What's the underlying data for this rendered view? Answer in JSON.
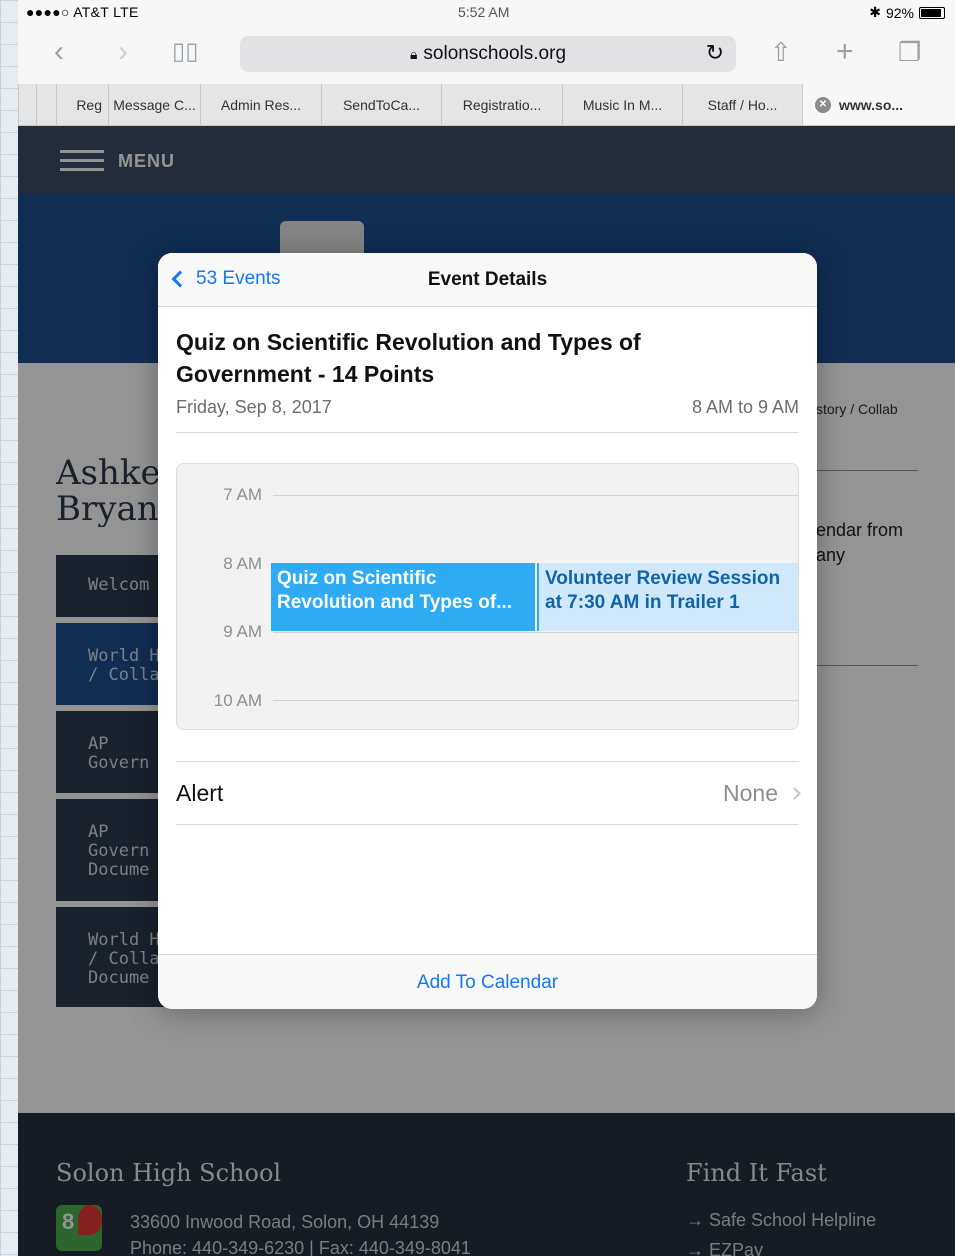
{
  "status": {
    "carrier": "●●●●○ AT&T  LTE",
    "time": "5:52 AM",
    "bluetooth": "✱",
    "battery": "92%"
  },
  "browser": {
    "url": "solonschools.org",
    "lock_icon": "lock-icon",
    "tabs": [
      {
        "label": "Reg"
      },
      {
        "label": "Message C..."
      },
      {
        "label": "Admin Res..."
      },
      {
        "label": "SendToCa..."
      },
      {
        "label": "Registratio..."
      },
      {
        "label": "Music In M..."
      },
      {
        "label": "Staff / Ho..."
      },
      {
        "label": "www.so..."
      }
    ]
  },
  "site": {
    "menu_label": "MENU",
    "breadcrumb": "story / Collab",
    "teacher_name_l1": "Ashke",
    "teacher_name_l2": "Bryan",
    "sidebar": [
      {
        "l1": "Welcom",
        "l2": "",
        "l3": ""
      },
      {
        "l1": "World H",
        "l2": "/ Collab",
        "l3": ""
      },
      {
        "l1": "AP",
        "l2": "Govern",
        "l3": ""
      },
      {
        "l1": "AP",
        "l2": "Govern",
        "l3": "Docume"
      },
      {
        "l1": "World H",
        "l2": "/ Collab",
        "l3": "Docume"
      }
    ],
    "right_text_l1": "endar from",
    "right_text_l2": "any",
    "footer": {
      "school_title": "Solon High School",
      "address": "33600 Inwood Road, Solon, OH 44139",
      "phone": "Phone: 440-349-6230  |  Fax: 440-349-8041",
      "find_title": "Find It Fast",
      "links": [
        "→  Safe School Helpline",
        "→  EZPay"
      ]
    }
  },
  "popover": {
    "back_label": "53 Events",
    "title": "Event Details",
    "event_title": "Quiz on Scientific Revolution and Types of Government - 14 Points",
    "date": "Friday, Sep 8, 2017",
    "time_range": "8 AM to 9 AM",
    "hours": [
      "7 AM",
      "8 AM",
      "9 AM",
      "10 AM"
    ],
    "event_a_l1": "Quiz on Scientific",
    "event_a_l2": "Revolution and Types of...",
    "event_b_l1": "Volunteer Review Session",
    "event_b_l2": "at 7:30 AM in Trailer 1",
    "alert_label": "Alert",
    "alert_value": "None",
    "add_button": "Add To Calendar",
    "colors": {
      "accent": "#1478f5",
      "event_primary": "#2fabf3",
      "event_secondary": "#cfe9fb"
    }
  }
}
